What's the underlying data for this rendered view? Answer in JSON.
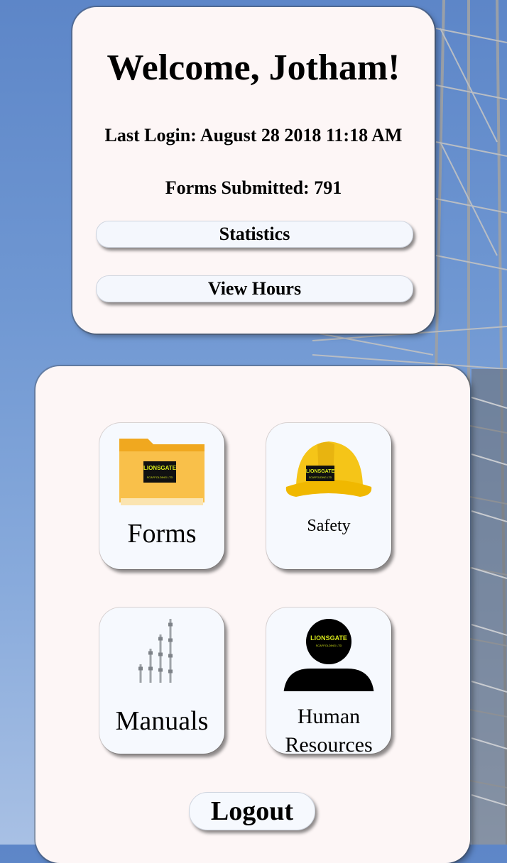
{
  "welcome": {
    "title": "Welcome, Jotham!",
    "last_login": "Last Login: August 28 2018 11:18 AM",
    "forms_submitted": "Forms Submitted: 791",
    "statistics_label": "Statistics",
    "view_hours_label": "View Hours"
  },
  "menu": {
    "forms_label": "Forms",
    "safety_label": "Safety",
    "manuals_label": "Manuals",
    "hr_label_line1": "Human",
    "hr_label_line2": "Resources",
    "logo_line1": "LIONSGATE",
    "logo_line2": "SCAFFOLDING LTD",
    "logout_label": "Logout"
  },
  "colors": {
    "card_bg": "#fdf6f6",
    "tile_bg": "#f6f9fe",
    "folder": "#f7b733",
    "hardhat": "#f5c518",
    "logo_text": "#d6e61a"
  }
}
